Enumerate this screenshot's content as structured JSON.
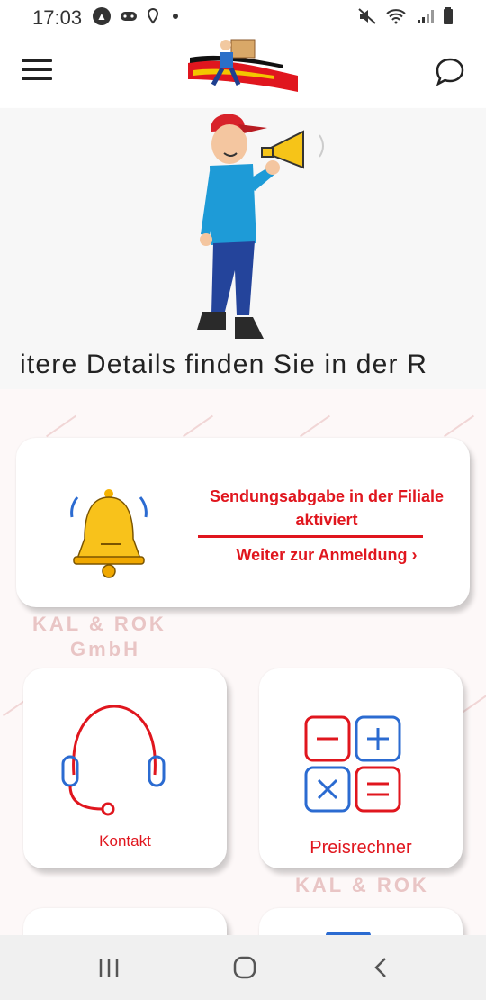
{
  "status_bar": {
    "time": "17:03",
    "icons_left": [
      "a-badge-icon",
      "gamepad-icon",
      "location-pin-icon",
      "dot-icon"
    ],
    "icons_right": [
      "mute-icon",
      "wifi-icon",
      "signal-icon",
      "battery-icon"
    ]
  },
  "header": {
    "menu_icon": "hamburger-menu-icon",
    "logo_icon": "courier-logo-icon",
    "chat_icon": "chat-bubble-icon"
  },
  "hero": {
    "ticker_text": "itere Details finden Sie in der R"
  },
  "watermark": {
    "line1": "KAL & ROK",
    "line2": "GmbH",
    "line3": "KAL & ROK"
  },
  "notice": {
    "title": "Sendungsabgabe in der Filiale aktiviert",
    "link": "Weiter zur Anmeldung ›",
    "accent_color": "#e0161e"
  },
  "tiles": [
    {
      "label": "Kontakt",
      "icon": "headset-icon"
    },
    {
      "label": "Preisrechner",
      "icon": "calculator-icon"
    }
  ],
  "nav": {
    "recents": "recents-icon",
    "home": "home-icon",
    "back": "back-icon"
  }
}
